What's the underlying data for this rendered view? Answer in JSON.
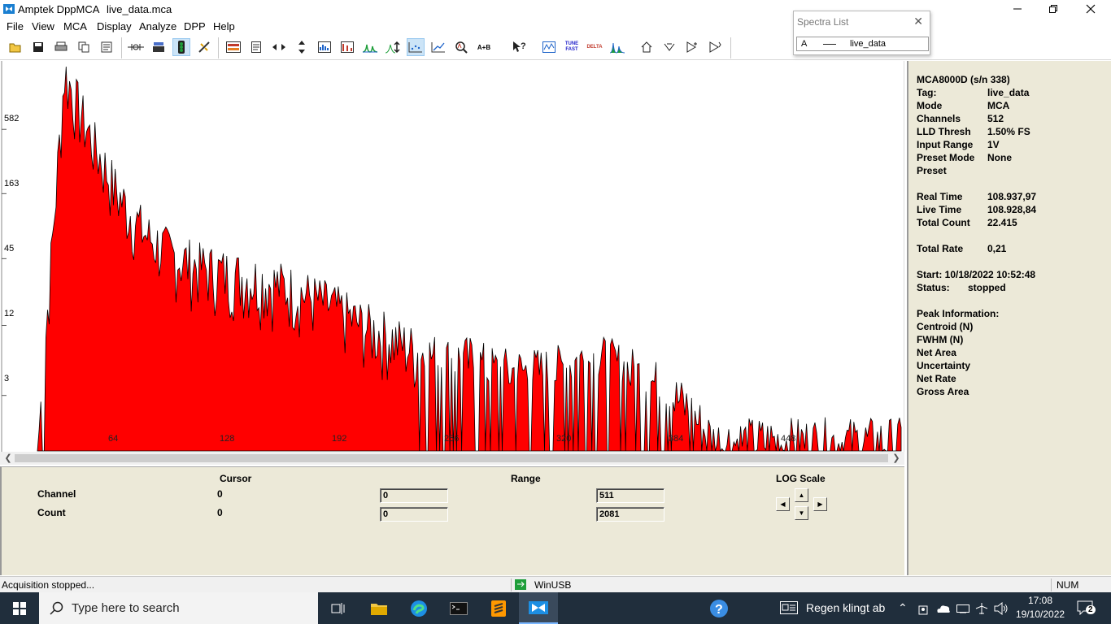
{
  "window": {
    "app_title": "Amptek DppMCA",
    "file_name": "live_data.mca"
  },
  "menu": [
    "File",
    "View",
    "MCA",
    "Display",
    "Analyze",
    "DPP",
    "Help"
  ],
  "spectra_list": {
    "title": "Spectra List",
    "row_letter": "A",
    "row_name": "live_data"
  },
  "toolbar": {
    "icons": [
      "open-icon",
      "save-icon",
      "print-icon",
      "copy-icon",
      "report-icon",
      "connect-icon",
      "setup-icon",
      "acquire-icon",
      "calibrate-icon",
      "roi-icon",
      "page-icon",
      "zoom-horizontal-icon",
      "zoom-vertical-icon",
      "auto-scale-icon",
      "fit-icon",
      "peak-icon",
      "scale-toggle-icon",
      "points-icon",
      "line-icon",
      "search-peak-icon",
      "add-spectra-icon",
      "help-cursor-icon",
      "tune-icon",
      "tune-fast-icon",
      "delta-icon",
      "peaks-icon",
      "home-icon",
      "down-icon",
      "next-icon",
      "next-2-icon"
    ],
    "tune_fast_label": "TUNE FAST",
    "delta_label": "DELTA",
    "ab_label": "A+B"
  },
  "plot": {
    "y_ticks": [
      "582",
      "163",
      "45",
      "12",
      "3"
    ],
    "x_ticks": [
      "64",
      "128",
      "192",
      "256",
      "320",
      "384",
      "448"
    ],
    "fill_color": "#ff0000"
  },
  "chart_data": {
    "type": "area",
    "xlabel": "",
    "ylabel": "",
    "x_range": [
      0,
      511
    ],
    "y_scale": "log",
    "y_ticks": [
      3,
      12,
      45,
      163,
      582
    ],
    "x_ticks": [
      64,
      128,
      192,
      256,
      320,
      384,
      448
    ],
    "series": [
      {
        "x": [
          0,
          16,
          32,
          48,
          64,
          80,
          96,
          112,
          128,
          144,
          160,
          176,
          192,
          208,
          224,
          240,
          256,
          272,
          288,
          304,
          320,
          336,
          352,
          368,
          384,
          400,
          416,
          432,
          448,
          464,
          480,
          496,
          511
        ],
        "values": [
          0,
          1500,
          400,
          130,
          60,
          40,
          32,
          28,
          25,
          22,
          18,
          14,
          10,
          8,
          6,
          5,
          5,
          4,
          4,
          4,
          5,
          5,
          4,
          3,
          2,
          1,
          1,
          1,
          1,
          1,
          1,
          1,
          1
        ]
      }
    ]
  },
  "controls": {
    "cursor_header": "Cursor",
    "range_header": "Range",
    "log_header": "LOG Scale",
    "channel_label": "Channel",
    "count_label": "Count",
    "cursor_channel": "0",
    "cursor_count": "0",
    "range_channel_low": "0",
    "range_channel_high": "511",
    "range_count_low": "0",
    "range_count_high": "2081"
  },
  "info": {
    "device": "MCA8000D (s/n     338)",
    "rows": [
      {
        "label": "Tag:",
        "value": "live_data"
      },
      {
        "label": "Mode",
        "value": "MCA"
      },
      {
        "label": "Channels",
        "value": "512"
      },
      {
        "label": "LLD Thresh",
        "value": "1.50% FS"
      },
      {
        "label": "Input Range",
        "value": "1V"
      },
      {
        "label": "Preset Mode",
        "value": "None"
      },
      {
        "label": "Preset",
        "value": ""
      }
    ],
    "real_time_label": "Real Time",
    "real_time": "108.937,97",
    "live_time_label": "Live Time",
    "live_time": "108.928,84",
    "total_count_label": "Total Count",
    "total_count": "22.415",
    "total_rate_label": "Total Rate",
    "total_rate": "0,21",
    "start": "Start:  10/18/2022 10:52:48",
    "status_label": "Status:",
    "status": "stopped",
    "peak_header": "Peak Information:",
    "peak_rows": [
      "Centroid (N)",
      "FWHM (N)",
      "Net Area",
      "Uncertainty",
      "Net Rate",
      "Gross Area"
    ]
  },
  "statusbar": {
    "message": "Acquisition stopped...",
    "connection": "WinUSB",
    "num": "NUM"
  },
  "taskbar": {
    "search_placeholder": "Type here to search",
    "weather": "Regen klingt ab",
    "time": "17:08",
    "date": "19/10/2022",
    "notifications": "2"
  }
}
